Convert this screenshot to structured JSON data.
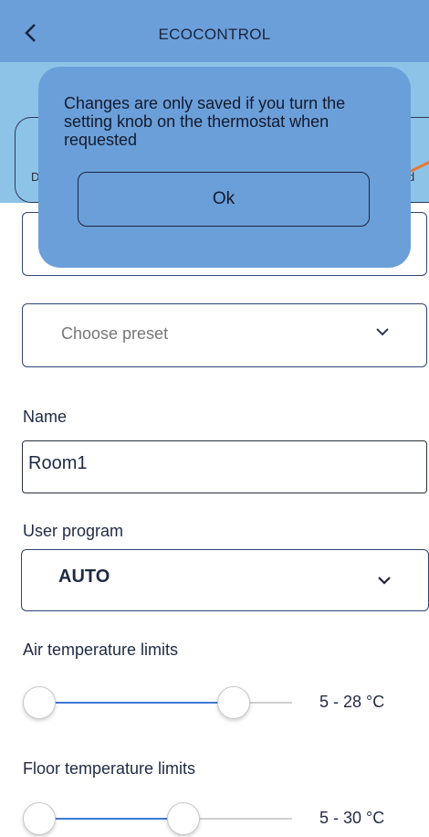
{
  "header": {
    "title": "ECOCONTROL",
    "back_icon": "chevron-left-icon"
  },
  "mode_tabs": {
    "left_label_partial": "D",
    "right_label_partial": "d"
  },
  "preset": {
    "placeholder": "Choose preset",
    "chevron_icon": "chevron-down-icon"
  },
  "name": {
    "label": "Name",
    "value": "Room1"
  },
  "user_program": {
    "label": "User program",
    "value": "AUTO",
    "chevron_icon": "chevron-down-icon"
  },
  "air_limits": {
    "label": "Air temperature limits",
    "range_text": "5 - 28 °C",
    "min": 5,
    "max": 28
  },
  "floor_limits": {
    "label": "Floor temperature limits",
    "range_text": "5 - 30 °C",
    "min": 5,
    "max": 30
  },
  "dialog": {
    "message": "Changes are only saved if you turn the setting knob on the thermostat when requested",
    "ok_label": "Ok"
  },
  "colors": {
    "header_bg": "#6b9fd9",
    "modebar_bg": "#8ec3e8",
    "slider_active": "#3e79d9",
    "accent_orange": "#e8782a"
  }
}
